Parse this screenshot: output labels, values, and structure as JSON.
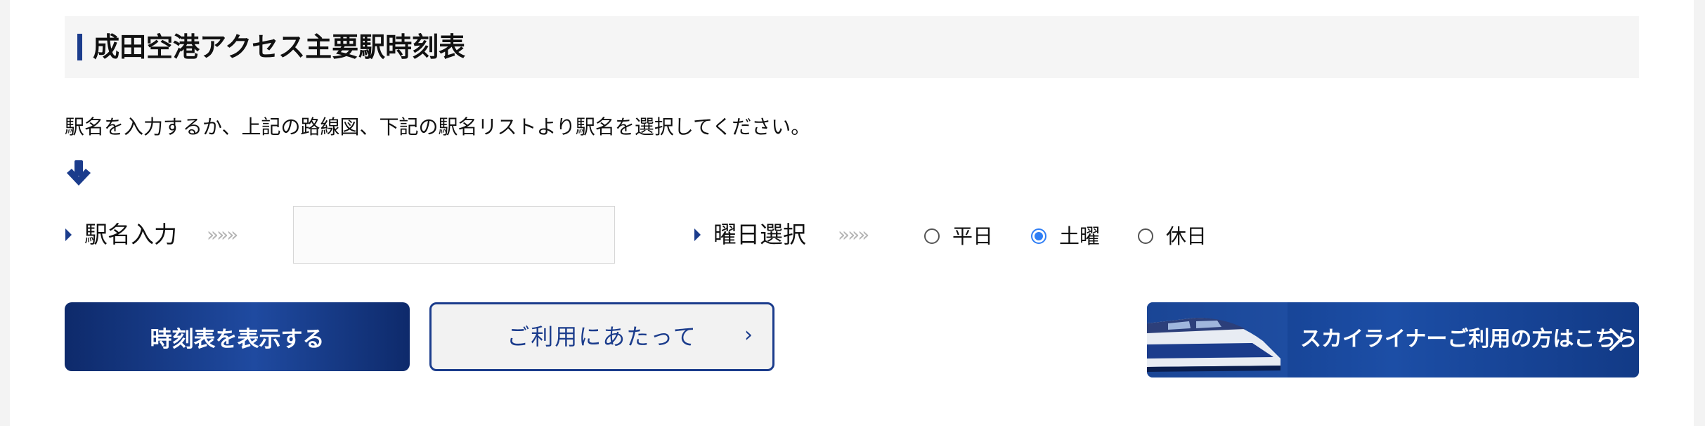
{
  "section": {
    "title": "成田空港アクセス主要駅時刻表",
    "instruction": "駅名を入力するか、上記の路線図、下記の駅名リストより駅名を選択してください。"
  },
  "station_input": {
    "label": "駅名入力",
    "chevrons": "»»»",
    "value": "",
    "placeholder": ""
  },
  "day_select": {
    "label": "曜日選択",
    "chevrons": "»»»",
    "options": [
      {
        "label": "平日",
        "checked": false
      },
      {
        "label": "土曜",
        "checked": true
      },
      {
        "label": "休日",
        "checked": false
      }
    ]
  },
  "buttons": {
    "show_timetable": "時刻表を表示する",
    "usage_notes": "ご利用にあたって",
    "usage_arrow": "›"
  },
  "banner": {
    "text": "スカイライナーご利用の方はこちら"
  },
  "colors": {
    "accent": "#1b3c8c",
    "radio_selected": "#2f7ef5",
    "chevron": "#b5b5b5"
  }
}
